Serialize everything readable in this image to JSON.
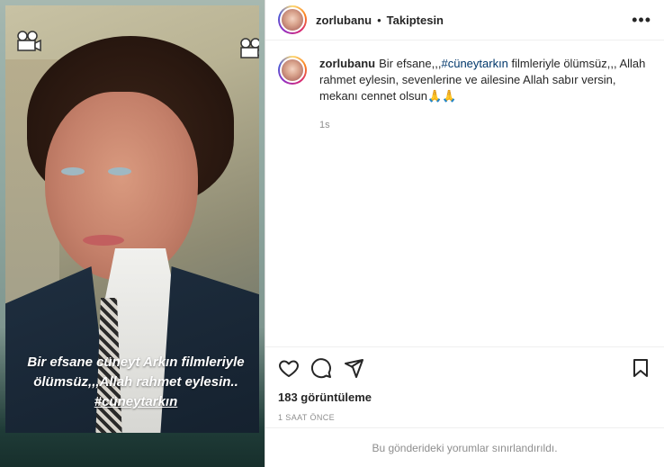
{
  "post": {
    "username": "zorlubanu",
    "separator": "•",
    "follow_status": "Takiptesin",
    "more_label": "•••"
  },
  "story_overlay": {
    "text_plain": "Bir efsane cüneyt Arkın filmleriyle ölümsüz,,,Allah rahmet eylesin..",
    "text_tag": "#cüneytarkın"
  },
  "caption": {
    "username": "zorlubanu",
    "text_part1": "Bir efsane,,,",
    "hashtag": "#cüneytarkın",
    "text_part2": " filmleriyle ölümsüz,,, Allah rahmet eylesin, sevenlerine ve ailesine Allah sabır versin, mekanı cennet olsun🙏🙏",
    "age": "1s"
  },
  "stats": {
    "views": "183 görüntüleme",
    "posted": "1 SAAT ÖNCE"
  },
  "comments_notice": "Bu gönderideki yorumlar sınırlandırıldı.",
  "icons": {
    "like": "heart-icon",
    "comment": "comment-icon",
    "share": "share-icon",
    "save": "bookmark-icon",
    "camera": "film-camera-icon"
  },
  "colors": {
    "text": "#262626",
    "muted": "#8e8e8e",
    "hashtag": "#00376b",
    "divider": "#efefef"
  }
}
